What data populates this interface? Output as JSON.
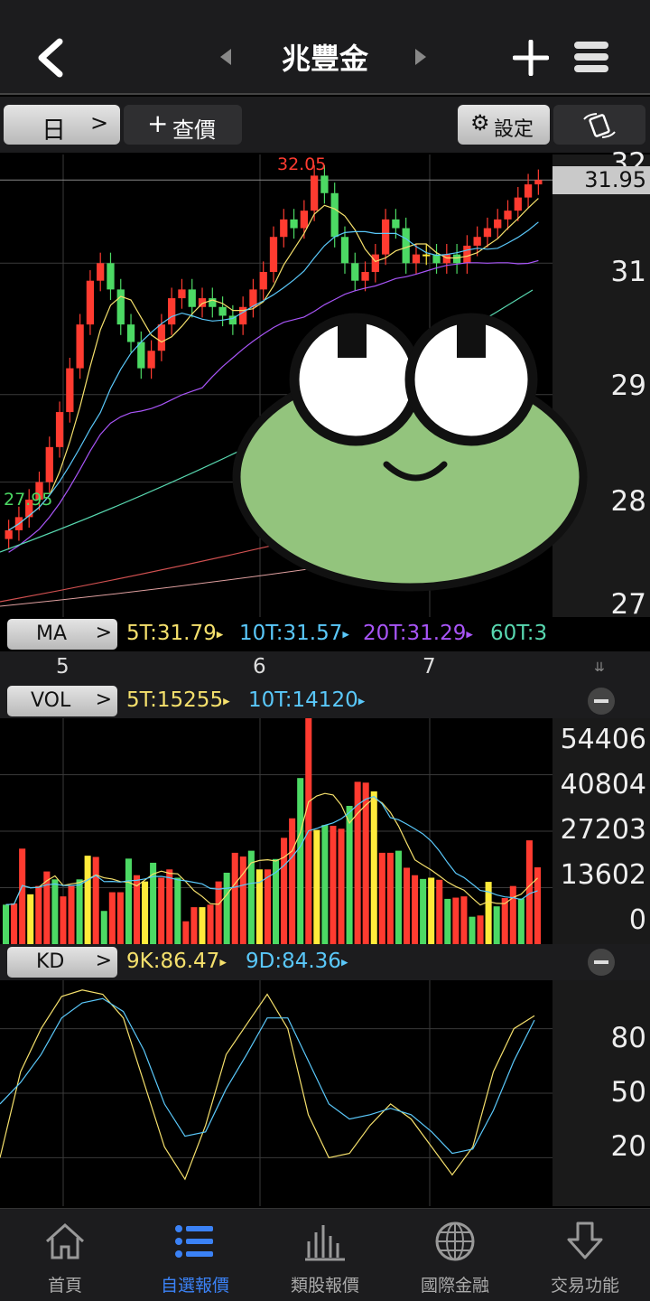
{
  "header": {
    "title": "兆豐金"
  },
  "toolbar": {
    "period": "日",
    "query_label": "查價",
    "settings_label": "設定"
  },
  "price_panel": {
    "axis_ticks": [
      "32",
      "31",
      "29",
      "28",
      "27"
    ],
    "last_price": "31.95",
    "high_label": "32.05",
    "low_label": "27.95"
  },
  "ma_bar": {
    "label": "MA",
    "t5": "5T:31.79",
    "t10": "10T:31.57",
    "t20": "20T:31.29",
    "t60": "60T:3"
  },
  "dates": [
    "5",
    "6",
    "7"
  ],
  "vol_bar": {
    "label": "VOL",
    "t5": "5T:15255",
    "t10": "10T:14120",
    "axis_ticks": [
      "54406",
      "40804",
      "27203",
      "13602",
      "0"
    ]
  },
  "kd_bar": {
    "label": "KD",
    "k": "9K:86.47",
    "d": "9D:84.36",
    "axis_ticks": [
      "80",
      "50",
      "20"
    ]
  },
  "tabs": [
    {
      "label": "首頁",
      "icon": "home-icon",
      "active": false
    },
    {
      "label": "自選報價",
      "icon": "list-icon",
      "active": true
    },
    {
      "label": "類股報價",
      "icon": "bar-chart-icon",
      "active": false
    },
    {
      "label": "國際金融",
      "icon": "globe-icon",
      "active": false
    },
    {
      "label": "交易功能",
      "icon": "download-arrow-icon",
      "active": false
    }
  ],
  "colors": {
    "up": "#ff3b30",
    "down": "#4cd964",
    "flat": "#ffeb3b",
    "ma5": "#f5e06c",
    "ma10": "#5ac8fa",
    "ma20": "#a855f7",
    "ma60": "#58d8b0",
    "active_tab": "#3b82f6"
  },
  "chart_data": [
    {
      "type": "candlestick",
      "title": "兆豐金",
      "ylim": [
        27,
        32.2
      ],
      "high": 32.05,
      "low": 27.95,
      "last": 31.95,
      "series": [
        {
          "name": "5T",
          "values": [
            31.79
          ]
        },
        {
          "name": "10T",
          "values": [
            31.57
          ]
        },
        {
          "name": "20T",
          "values": [
            31.29
          ]
        }
      ],
      "x_tick_labels": [
        "5",
        "6",
        "7"
      ]
    },
    {
      "type": "bar",
      "title": "VOL",
      "ylim": [
        0,
        54406
      ],
      "y_tick_labels": [
        "54406",
        "40804",
        "27203",
        "13602",
        "0"
      ],
      "series": [
        {
          "name": "VOL",
          "values": [
            9500,
            9800,
            23000,
            12000,
            14000,
            17500,
            15600,
            11500,
            14000,
            15600,
            21300,
            21000,
            8000,
            12500,
            12500,
            20600,
            16600,
            15100,
            19600,
            16000,
            18000,
            16000,
            5500,
            8900,
            8900,
            9500,
            15100,
            17200,
            22000,
            21100,
            22500,
            18000,
            18000,
            20500,
            25600,
            30300,
            40000,
            55000,
            27500,
            28700,
            28500,
            27800,
            33300,
            39100,
            38900,
            36800,
            22000,
            22000,
            22500,
            18400,
            16600,
            15700,
            16000,
            15500,
            10900,
            11200,
            11500,
            6600,
            6900,
            15000,
            9100,
            11100,
            14000,
            11000,
            25000,
            18500
          ]
        }
      ]
    },
    {
      "type": "line",
      "title": "KD",
      "ylim": [
        0,
        100
      ],
      "y_tick_labels": [
        "80",
        "50",
        "20"
      ],
      "series": [
        {
          "name": "9K",
          "values": [
            20,
            60,
            80,
            95,
            98,
            96,
            85,
            55,
            25,
            10,
            35,
            68,
            82,
            96,
            80,
            40,
            20,
            22,
            35,
            45,
            38,
            25,
            12,
            25,
            60,
            80,
            86
          ]
        },
        {
          "name": "9D",
          "values": [
            45,
            55,
            68,
            85,
            92,
            94,
            88,
            70,
            45,
            30,
            32,
            52,
            68,
            85,
            85,
            65,
            45,
            38,
            40,
            43,
            40,
            32,
            22,
            24,
            42,
            65,
            84
          ]
        }
      ]
    }
  ]
}
